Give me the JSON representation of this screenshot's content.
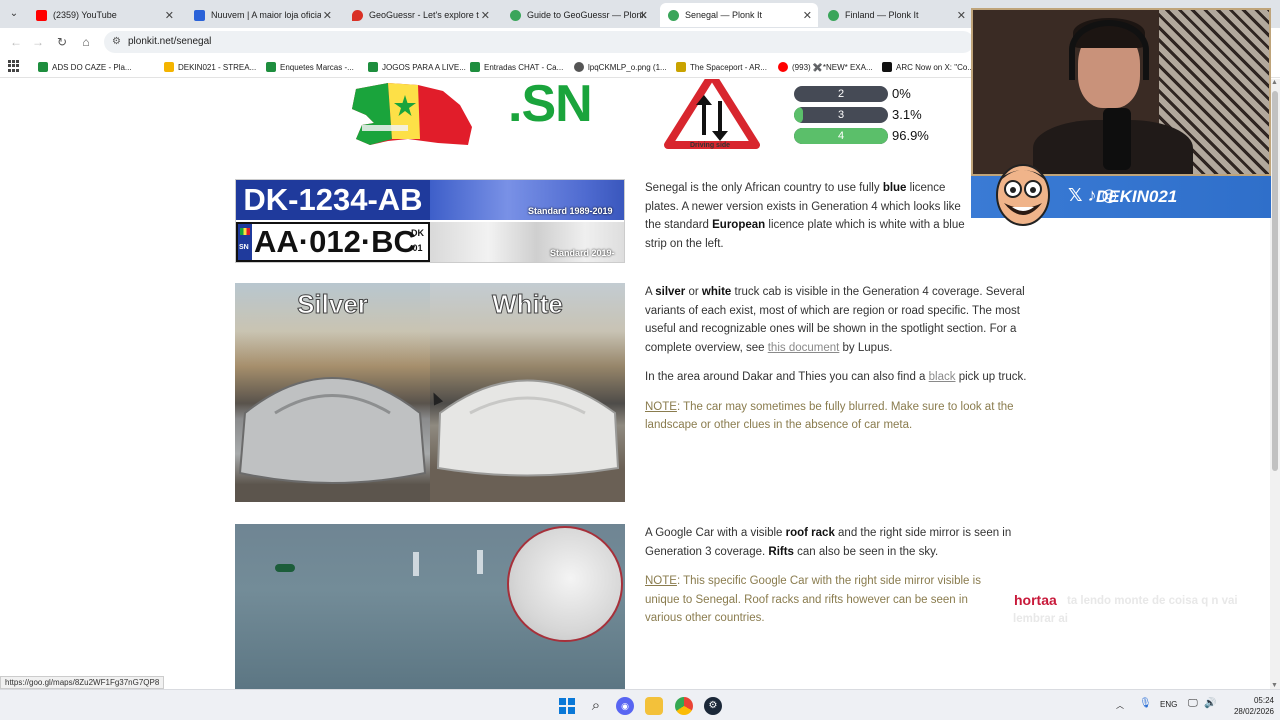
{
  "tabs": [
    {
      "title": "(2359) YouTube",
      "color": "#ff0000"
    },
    {
      "title": "Nuuvem | A maior loja oficial d",
      "color": "#2a62d8"
    },
    {
      "title": "GeoGuessr - Let's explore the w",
      "color": "#d93025"
    },
    {
      "title": "Guide to GeoGuessr — Plonk It",
      "color": "#3aa55a"
    },
    {
      "title": "Senegal — Plonk It",
      "color": "#3aa55a",
      "active": true
    },
    {
      "title": "Finland — Plonk It",
      "color": "#3aa55a"
    }
  ],
  "address_bar": {
    "url": "plonkit.net/senegal"
  },
  "bookmarks": [
    {
      "label": "ADS DO CAZE - Pla...",
      "color": "#1e8e3e"
    },
    {
      "label": "DEKIN021 - STREA...",
      "color": "#f4b400"
    },
    {
      "label": "Enquetes Marcas -...",
      "color": "#1e8e3e"
    },
    {
      "label": "JOGOS PARA A LIVE...",
      "color": "#1e8e3e"
    },
    {
      "label": "Entradas CHAT - Ca...",
      "color": "#1e8e3e"
    },
    {
      "label": "lpqCKMLP_o.png (1...",
      "color": "#555555"
    },
    {
      "label": "The Spaceport - AR...",
      "color": "#c9a300"
    },
    {
      "label": "(993) ✖️*NEW* EXA...",
      "color": "#ff0000"
    },
    {
      "label": "ARC Now on X: \"Co...",
      "color": "#111111"
    }
  ],
  "header_section": {
    "tld": ".SN",
    "driving_side_caption": "Driving side",
    "bars": [
      {
        "label": "2",
        "percent_text": "0%",
        "fraction": 0.0
      },
      {
        "label": "3",
        "percent_text": "3.1%",
        "fraction": 0.1
      },
      {
        "label": "4",
        "percent_text": "96.9%",
        "fraction": 1.0
      }
    ]
  },
  "plates": {
    "plate1_text": "DK-1234-AB",
    "plate1_caption": "Standard 1989-2019",
    "plate2_text": "AA·012·BC",
    "plate2_side_top": "DK",
    "plate2_side_bottom": "01",
    "plate2_stripe": "SN",
    "plate2_caption": "Standard 2019-"
  },
  "plate_text": {
    "p1": "Senegal is the only African country to use fully ",
    "b1": "blue",
    "p2": " licence plates. A newer version exists in Generation 4 which looks like the standard ",
    "b2": "European",
    "p3": " licence plate which is white with a blue strip on the left."
  },
  "car_photo": {
    "label_left": "Silver",
    "label_right": "White"
  },
  "car_text": {
    "p1": "A ",
    "b1": "silver",
    "p2": " or ",
    "b2": "white",
    "p3": " truck cab is visible in the Generation 4 coverage. Several variants of each exist, most of which are region or road specific. The most useful and recognizable ones will be shown in the spotlight section. For a complete overview, see ",
    "link": "this document",
    "p4": " by Lupus.",
    "p5": "In the area around Dakar and Thies you can also find a ",
    "link2": "black",
    "p6": " pick up truck.",
    "note_label": "NOTE",
    "note_text": ": The car may sometimes be fully blurred. Make sure to look at the landscape or other clues in the absence of car meta."
  },
  "roof_text": {
    "p1": "A Google Car with a visible ",
    "b1": "roof rack",
    "p2": " and the right side mirror is seen in Generation 3 coverage. ",
    "b2": "Rifts",
    "p3": " can also be seen in the sky.",
    "note_label": "NOTE",
    "note_text": ": This specific Google Car with the right side mirror visible is unique to Senegal. Roof racks and rifts however can be seen in various other countries."
  },
  "stream_overlay": {
    "handle": "DEKIN021",
    "chat_user": "hortaa",
    "chat_message": "ta lendo monte de coisa q n vai lembrar ai"
  },
  "status_bar": {
    "link": "https://goo.gl/maps/8Zu2WF1Fg37nG7QP8"
  },
  "system_tray": {
    "language": "ENG",
    "time": "05:24",
    "date": "28/02/2026"
  }
}
